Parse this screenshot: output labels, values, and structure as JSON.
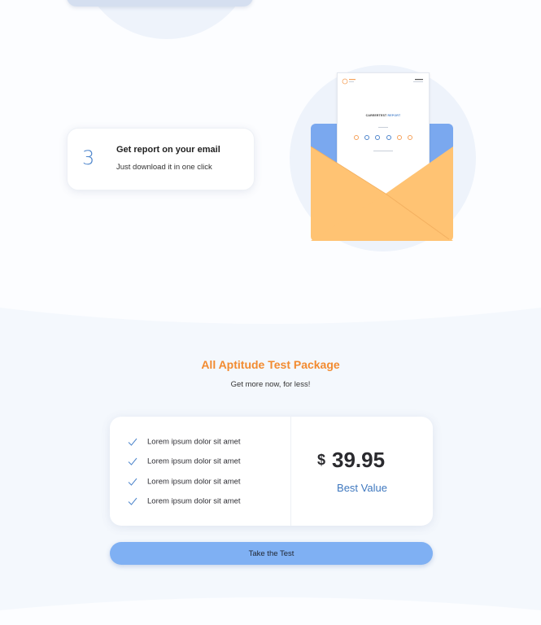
{
  "step": {
    "number": "3",
    "title": "Get report on your email",
    "description": "Just download it in one click"
  },
  "illustration": {
    "report_title_a": "CAREERTEST",
    "report_title_b": " REPORT"
  },
  "package": {
    "title": "All Aptitude Test Package",
    "subtitle": "Get more now, for less!",
    "features": [
      "Lorem ipsum dolor sit amet",
      "Lorem ipsum dolor sit amet",
      "Lorem ipsum dolor sit amet",
      "Lorem ipsum dolor sit amet"
    ],
    "currency": "$",
    "price": "39.95",
    "badge": "Best Value",
    "cta_label": "Take the Test"
  },
  "colors": {
    "accent_orange": "#f28b30",
    "accent_blue": "#4f86cc",
    "button_blue": "#7fb0f3",
    "envelope_yellow": "#ffc373",
    "section_bg": "#f4f8fd"
  },
  "icons": [
    "check-icon",
    "envelope-icon"
  ]
}
